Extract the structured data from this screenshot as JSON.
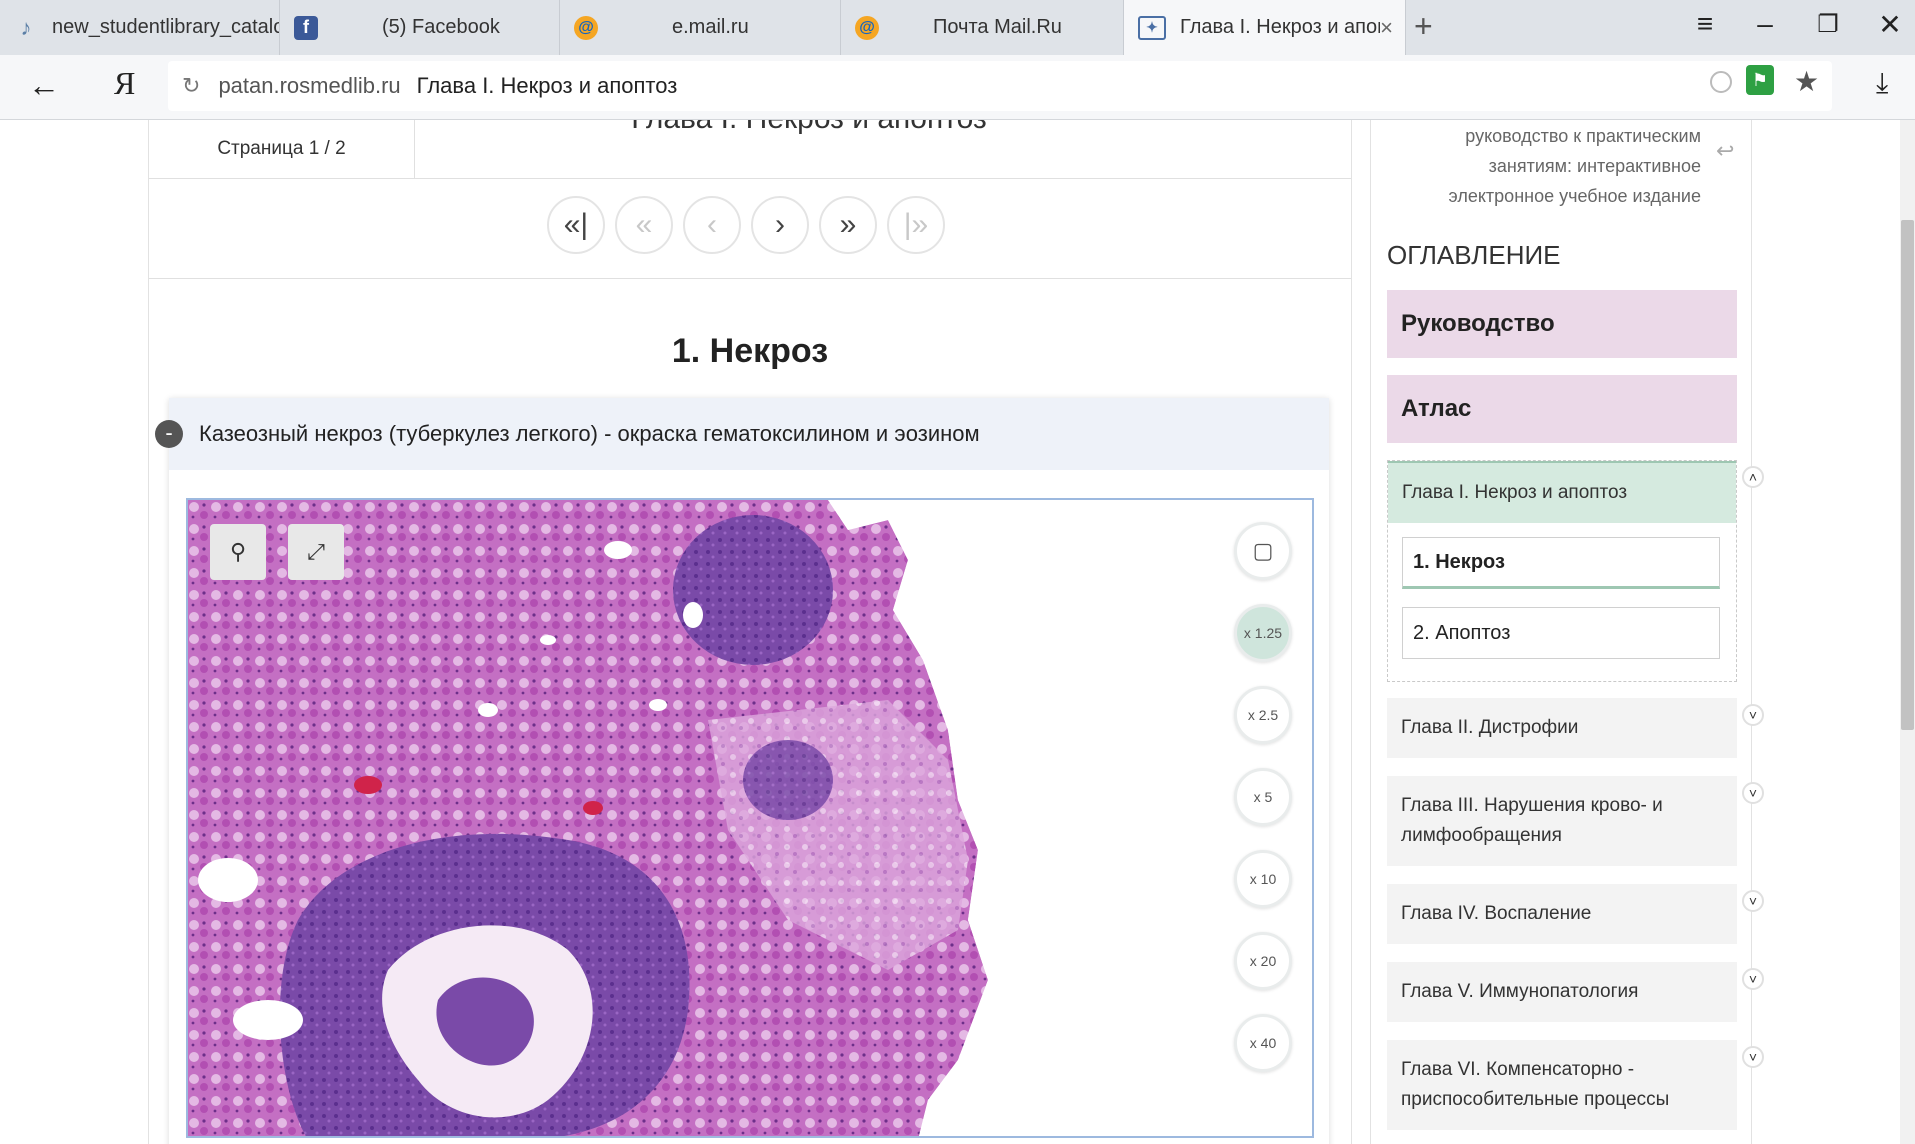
{
  "browser": {
    "tabs": [
      {
        "label": "new_studentlibrary_catalogu",
        "icon": "note-icon"
      },
      {
        "label": "(5) Facebook",
        "icon": "facebook-icon"
      },
      {
        "label": "e.mail.ru",
        "icon": "mail-icon"
      },
      {
        "label": "Почта Mail.Ru",
        "icon": "mail-icon"
      },
      {
        "label": "Глава I. Некроз и апопто",
        "icon": "page-icon",
        "active": true
      }
    ],
    "url_host": "patan.rosmedlib.ru",
    "page_title": "Глава I. Некроз и апоптоз",
    "ya_label": "Я"
  },
  "content": {
    "page_label": "Страница 1 / 2",
    "chapter_title": "Глава I. Некроз и апоптоз",
    "section_title": "1. Некроз",
    "figure": {
      "title": "Казеозный некроз (туберкулез легкого) - окраска гематоксилином и эозином",
      "zoom_levels": [
        "x 1.25",
        "x 2.5",
        "x 5",
        "x 10",
        "x 20",
        "x 40"
      ],
      "active_zoom": "x 1.25"
    }
  },
  "sidebar": {
    "book_lines": [
      "руководство к практическим",
      "занятиям: интерактивное",
      "электронное учебное издание"
    ],
    "toc_heading": "ОГЛАВЛЕНИЕ",
    "top_items": [
      "Руководство",
      "Атлас"
    ],
    "open_chapter": {
      "title": "Глава I. Некроз и апоптоз",
      "items": [
        "1. Некроз",
        "2. Апоптоз"
      ],
      "current": "1. Некроз"
    },
    "chapters": [
      "Глава II. Дистрофии",
      "Глава III. Нарушения крово- и лимфообращения",
      "Глава IV. Воспаление",
      "Глава V. Иммунопатология",
      "Глава VI. Компенсаторно - приспособительные процессы"
    ]
  },
  "colors": {
    "accent_green": "#cfe5dc",
    "toc_pink": "#ebd9e8",
    "tissue_pink": "#c06cc0",
    "tissue_purple": "#6a3a9a"
  }
}
